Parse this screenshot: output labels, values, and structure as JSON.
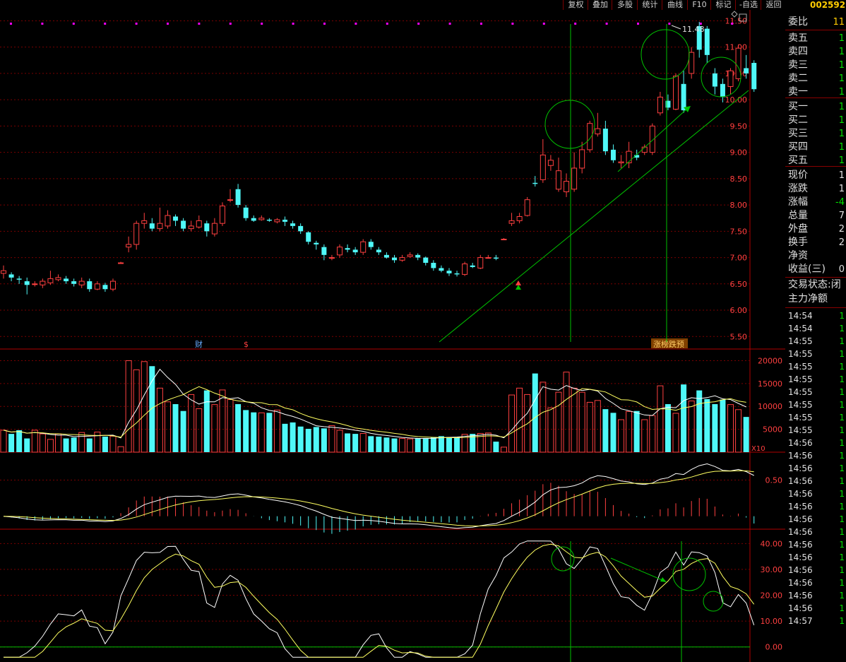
{
  "toolbar": {
    "buttons": [
      "复权",
      "叠加",
      "多股",
      "统计",
      "曲线",
      "F10",
      "标记",
      "-自选",
      "返回"
    ],
    "stock_code": "002592"
  },
  "right_panel": {
    "rows": [
      {
        "label": "委比",
        "value": "11"
      },
      {
        "label": "卖五",
        "value": "1"
      },
      {
        "label": "卖四",
        "value": "1"
      },
      {
        "label": "卖三",
        "value": "1"
      },
      {
        "label": "卖二",
        "value": "1"
      },
      {
        "label": "卖一",
        "value": "1"
      },
      {
        "label": "买一",
        "value": "1"
      },
      {
        "label": "买二",
        "value": "1"
      },
      {
        "label": "买三",
        "value": "1"
      },
      {
        "label": "买四",
        "value": "1"
      },
      {
        "label": "买五",
        "value": "1"
      },
      {
        "label": "现价",
        "value": "1"
      },
      {
        "label": "涨跌",
        "value": "1"
      },
      {
        "label": "涨幅",
        "value": "-4"
      },
      {
        "label": "总量",
        "value": "7"
      },
      {
        "label": "外盘",
        "value": "2"
      },
      {
        "label": "换手",
        "value": "2"
      },
      {
        "label": "净资",
        "value": ""
      },
      {
        "label": "收益(三)",
        "value": "0"
      },
      {
        "label": "交易状态:闭",
        "value": ""
      },
      {
        "label": "主力净额",
        "value": ""
      }
    ],
    "ticks": [
      {
        "time": "14:54",
        "vol": "1"
      },
      {
        "time": "14:54",
        "vol": "1"
      },
      {
        "time": "14:55",
        "vol": "1"
      },
      {
        "time": "14:55",
        "vol": "1"
      },
      {
        "time": "14:55",
        "vol": "1"
      },
      {
        "time": "14:55",
        "vol": "1"
      },
      {
        "time": "14:55",
        "vol": "1"
      },
      {
        "time": "14:55",
        "vol": "1"
      },
      {
        "time": "14:55",
        "vol": "1"
      },
      {
        "time": "14:55",
        "vol": "1"
      },
      {
        "time": "14:56",
        "vol": "1"
      },
      {
        "time": "14:56",
        "vol": "1"
      },
      {
        "time": "14:56",
        "vol": "1"
      },
      {
        "time": "14:56",
        "vol": "1"
      },
      {
        "time": "14:56",
        "vol": "1"
      },
      {
        "time": "14:56",
        "vol": "1"
      },
      {
        "time": "14:56",
        "vol": "1"
      },
      {
        "time": "14:56",
        "vol": "1"
      },
      {
        "time": "14:56",
        "vol": "1"
      },
      {
        "time": "14:56",
        "vol": "1"
      },
      {
        "time": "14:56",
        "vol": "1"
      },
      {
        "time": "14:56",
        "vol": "1"
      },
      {
        "time": "14:56",
        "vol": "1"
      },
      {
        "time": "14:56",
        "vol": "1"
      },
      {
        "time": "14:57",
        "vol": "1"
      }
    ]
  },
  "colors": {
    "up": "#ff4040",
    "down": "#4ff8f8",
    "grid": "#7a0000",
    "axis_text": "#ff4040",
    "ma1": "#ffffff",
    "ma2": "#ffff60",
    "annotation": "#00c000",
    "marker": "#ff00ff"
  },
  "chart_data": [
    {
      "type": "candlestick",
      "name": "price",
      "ylim": [
        5.45,
        11.6
      ],
      "yticks": [
        "11.50",
        "11.00",
        "10.50",
        "10.00",
        "9.50",
        "9.00",
        "8.50",
        "8.00",
        "7.50",
        "7.00",
        "6.50",
        "6.00",
        "5.50"
      ],
      "high_label": "11.48",
      "event_labels": [
        "财",
        "$",
        "涨榜跌预"
      ],
      "candles": [
        [
          6.7,
          6.75,
          6.85,
          6.6
        ],
        [
          6.68,
          6.62,
          6.72,
          6.55
        ],
        [
          6.6,
          6.58,
          6.65,
          6.5
        ],
        [
          6.55,
          6.48,
          6.62,
          6.3
        ],
        [
          6.5,
          6.5,
          6.55,
          6.45
        ],
        [
          6.48,
          6.55,
          6.6,
          6.42
        ],
        [
          6.52,
          6.6,
          6.75,
          6.48
        ],
        [
          6.58,
          6.62,
          6.68,
          6.55
        ],
        [
          6.6,
          6.55,
          6.65,
          6.5
        ],
        [
          6.55,
          6.5,
          6.6,
          6.45
        ],
        [
          6.48,
          6.55,
          6.62,
          6.42
        ],
        [
          6.55,
          6.4,
          6.6,
          6.35
        ],
        [
          6.4,
          6.5,
          6.55,
          6.38
        ],
        [
          6.48,
          6.4,
          6.52,
          6.35
        ],
        [
          6.4,
          6.55,
          6.6,
          6.36
        ],
        [
          6.9,
          6.9,
          6.92,
          6.88
        ],
        [
          7.2,
          7.25,
          7.4,
          7.1
        ],
        [
          7.25,
          7.65,
          7.7,
          7.15
        ],
        [
          7.65,
          7.7,
          7.85,
          7.55
        ],
        [
          7.65,
          7.55,
          7.75,
          7.5
        ],
        [
          7.55,
          7.65,
          7.95,
          7.5
        ],
        [
          7.6,
          7.8,
          7.9,
          7.55
        ],
        [
          7.78,
          7.7,
          7.82,
          7.6
        ],
        [
          7.7,
          7.55,
          7.75,
          7.5
        ],
        [
          7.55,
          7.6,
          7.7,
          7.5
        ],
        [
          7.58,
          7.7,
          7.8,
          7.55
        ],
        [
          7.65,
          7.5,
          7.7,
          7.4
        ],
        [
          7.45,
          7.65,
          7.75,
          7.4
        ],
        [
          7.65,
          7.98,
          8.05,
          7.6
        ],
        [
          8.1,
          8.1,
          8.3,
          8.05
        ],
        [
          8.3,
          8.0,
          8.4,
          7.95
        ],
        [
          7.95,
          7.75,
          8.0,
          7.7
        ],
        [
          7.75,
          7.7,
          7.8,
          7.68
        ],
        [
          7.72,
          7.75,
          7.8,
          7.7
        ],
        [
          7.72,
          7.7,
          7.75,
          7.68
        ],
        [
          7.68,
          7.72,
          7.75,
          7.65
        ],
        [
          7.72,
          7.68,
          7.78,
          7.6
        ],
        [
          7.65,
          7.6,
          7.7,
          7.55
        ],
        [
          7.6,
          7.5,
          7.65,
          7.45
        ],
        [
          7.48,
          7.3,
          7.5,
          7.25
        ],
        [
          7.28,
          7.25,
          7.32,
          7.15
        ],
        [
          7.2,
          7.05,
          7.25,
          6.95
        ],
        [
          7.0,
          7.0,
          7.05,
          6.95
        ],
        [
          7.05,
          7.2,
          7.25,
          7.0
        ],
        [
          7.18,
          7.15,
          7.25,
          7.1
        ],
        [
          7.15,
          7.1,
          7.2,
          7.05
        ],
        [
          7.1,
          7.3,
          7.35,
          7.05
        ],
        [
          7.3,
          7.2,
          7.35,
          7.15
        ],
        [
          7.15,
          7.1,
          7.2,
          7.05
        ],
        [
          7.05,
          7.0,
          7.1,
          6.98
        ],
        [
          7.0,
          6.95,
          7.05,
          6.9
        ],
        [
          6.95,
          7.0,
          7.05,
          6.92
        ],
        [
          7.02,
          7.05,
          7.1,
          7.0
        ],
        [
          7.05,
          7.0,
          7.08,
          6.95
        ],
        [
          7.0,
          6.9,
          7.02,
          6.85
        ],
        [
          6.9,
          6.8,
          6.95,
          6.75
        ],
        [
          6.8,
          6.75,
          6.85,
          6.72
        ],
        [
          6.75,
          6.7,
          6.8,
          6.65
        ],
        [
          6.7,
          6.68,
          6.75,
          6.64
        ],
        [
          6.68,
          6.88,
          6.92,
          6.65
        ],
        [
          6.85,
          6.82,
          6.9,
          6.8
        ],
        [
          6.8,
          7.0,
          7.05,
          6.78
        ],
        [
          7.0,
          7.0,
          7.05,
          6.98
        ],
        [
          7.0,
          6.98,
          7.05,
          6.95
        ],
        [
          7.35,
          7.35,
          7.37,
          7.33
        ],
        [
          7.65,
          7.7,
          7.85,
          7.6
        ],
        [
          7.7,
          7.78,
          7.85,
          7.65
        ],
        [
          7.8,
          8.1,
          8.15,
          7.78
        ],
        [
          8.42,
          8.4,
          8.55,
          8.35
        ],
        [
          8.48,
          8.95,
          9.25,
          8.42
        ],
        [
          8.75,
          8.85,
          8.95,
          8.65
        ],
        [
          8.3,
          8.65,
          8.9,
          8.25
        ],
        [
          8.25,
          8.45,
          8.6,
          8.15
        ],
        [
          8.3,
          8.7,
          9.0,
          8.25
        ],
        [
          8.7,
          9.05,
          9.2,
          8.6
        ],
        [
          9.05,
          9.55,
          9.6,
          9.0
        ],
        [
          9.35,
          9.45,
          9.75,
          9.3
        ],
        [
          9.45,
          9.02,
          9.6,
          8.95
        ],
        [
          9.05,
          8.85,
          9.15,
          8.8
        ],
        [
          8.8,
          8.82,
          8.95,
          8.7
        ],
        [
          8.8,
          9.02,
          9.2,
          8.7
        ],
        [
          8.95,
          8.9,
          9.05,
          8.85
        ],
        [
          9.0,
          9.1,
          9.15,
          8.95
        ],
        [
          9.0,
          9.5,
          9.55,
          8.95
        ],
        [
          9.75,
          10.05,
          10.15,
          9.7
        ],
        [
          9.98,
          9.85,
          10.1,
          9.8
        ],
        [
          9.82,
          10.45,
          10.5,
          9.8
        ],
        [
          10.3,
          9.8,
          10.55,
          9.75
        ],
        [
          10.5,
          10.9,
          11.0,
          10.4
        ],
        [
          11.4,
          10.95,
          11.48,
          10.8
        ],
        [
          11.35,
          10.85,
          11.4,
          10.7
        ],
        [
          10.5,
          10.25,
          10.6,
          10.1
        ],
        [
          10.3,
          10.05,
          10.4,
          9.95
        ],
        [
          10.25,
          10.55,
          10.6,
          10.1
        ],
        [
          10.4,
          10.98,
          11.05,
          10.35
        ],
        [
          10.6,
          10.5,
          10.85,
          10.4
        ],
        [
          10.7,
          10.2,
          10.75,
          10.15
        ]
      ]
    },
    {
      "type": "bar",
      "name": "volume",
      "ylim": [
        0,
        21000
      ],
      "yticks": [
        "20000",
        "15000",
        "10000",
        "5000"
      ],
      "unit_label": "X10",
      "values": [
        4800,
        4000,
        4800,
        3000,
        4800,
        4000,
        2800,
        4000,
        3000,
        3200,
        4300,
        3000,
        4400,
        3400,
        3500,
        1200,
        20000,
        18000,
        19800,
        18800,
        14000,
        11000,
        10500,
        9000,
        12600,
        9500,
        13500,
        10400,
        13600,
        11500,
        10500,
        9200,
        8700,
        8600,
        8600,
        9200,
        6200,
        6500,
        5600,
        5100,
        5500,
        5200,
        5800,
        4800,
        4100,
        4000,
        4100,
        3500,
        3400,
        3200,
        3000,
        3000,
        2900,
        3000,
        3100,
        3300,
        3500,
        3300,
        3300,
        3900,
        4000,
        4100,
        4200,
        2300,
        1100,
        12500,
        14000,
        12600,
        17200,
        15300,
        9700,
        13100,
        17500,
        14000,
        13100,
        10900,
        11300,
        9400,
        8600,
        7100,
        8900,
        9000,
        7100,
        8000,
        14500,
        10500,
        8500,
        14800,
        11200,
        13500,
        11600,
        10500,
        11500,
        10400,
        9300,
        7700
      ]
    },
    {
      "type": "line",
      "name": "macd",
      "ylim": [
        -0.15,
        0.75
      ],
      "yticks": [
        "0.50"
      ]
    },
    {
      "type": "line",
      "name": "kdj",
      "ylim": [
        -5,
        42
      ],
      "yticks": [
        "40.00",
        "30.00",
        "20.00",
        "10.00",
        "0.00"
      ]
    }
  ]
}
